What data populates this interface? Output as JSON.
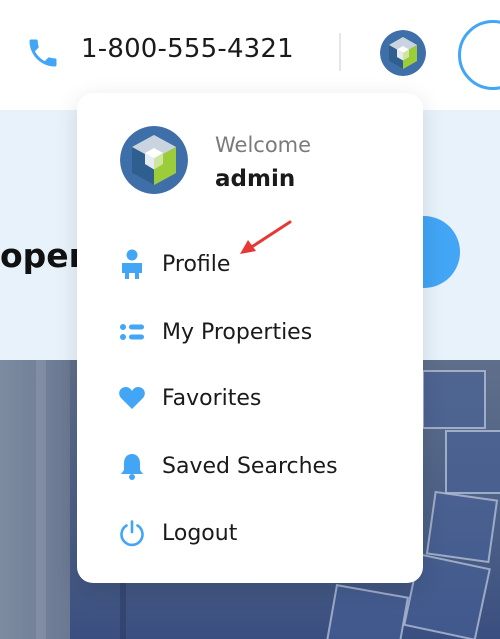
{
  "header": {
    "phone_icon": "phone-icon",
    "phone_number": "1-800-555-4321",
    "avatar_icon": "cube-avatar-icon"
  },
  "hero": {
    "title_partial": "oper"
  },
  "user_menu": {
    "welcome_label": "Welcome",
    "username": "admin",
    "items": [
      {
        "label": "Profile",
        "icon": "person-icon"
      },
      {
        "label": "My Properties",
        "icon": "list-icon"
      },
      {
        "label": "Favorites",
        "icon": "heart-icon"
      },
      {
        "label": "Saved Searches",
        "icon": "bell-icon"
      },
      {
        "label": "Logout",
        "icon": "power-icon"
      }
    ]
  },
  "annotation": {
    "icon": "red-arrow-icon",
    "points_to": "Profile"
  },
  "colors": {
    "accent": "#42a5f5",
    "hero_background": "#e8f2fb",
    "annotation_red": "#e53935",
    "text": "#1a1a1a",
    "muted_text": "#7a7a7a"
  }
}
